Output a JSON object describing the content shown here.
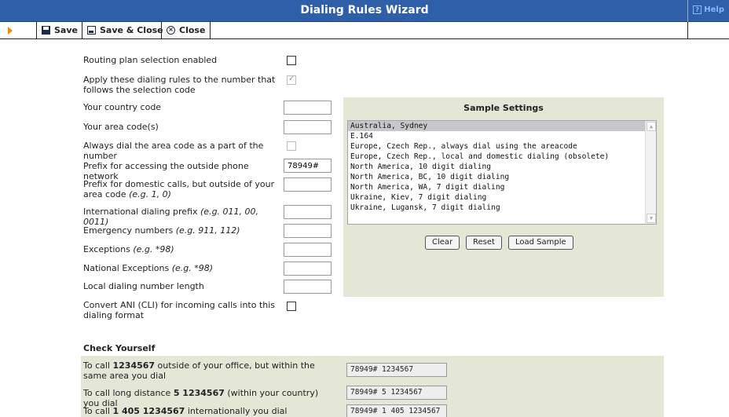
{
  "window": {
    "title": "Dialing Rules Wizard",
    "help_label": "Help",
    "help_icon": "?"
  },
  "toolbar": {
    "save_label": "Save",
    "save_close_label": "Save & Close",
    "close_label": "Close"
  },
  "form": {
    "routing_plan_label": "Routing plan selection enabled",
    "routing_plan_checked": false,
    "apply_rules_label": "Apply these dialing rules to the number that follows the selection code",
    "apply_rules_checked": true,
    "country_code_label": "Your country code",
    "country_code_value": "",
    "area_codes_label": "Your area code(s)",
    "area_codes_value": "",
    "always_dial_area_label": "Always dial the area code as a part of the number",
    "always_dial_area_checked": false,
    "outside_prefix_label": "Prefix for accessing the outside phone network",
    "outside_prefix_value": "78949#",
    "domestic_prefix_label": "Prefix for domestic calls, but outside of your area code",
    "domestic_prefix_hint": "(e.g. 1, 0)",
    "domestic_prefix_value": "",
    "intl_prefix_label": "International dialing prefix",
    "intl_prefix_hint": "(e.g. 011, 00, 0011)",
    "intl_prefix_value": "",
    "emergency_label": "Emergency numbers",
    "emergency_hint": "(e.g. 911, 112)",
    "emergency_value": "",
    "exceptions_label": "Exceptions",
    "exceptions_hint": "(e.g. *98)",
    "exceptions_value": "",
    "national_exceptions_label": "National Exceptions",
    "national_exceptions_hint": "(e.g. *98)",
    "national_exceptions_value": "",
    "local_length_label": "Local dialing number length",
    "local_length_value": "",
    "convert_ani_label": "Convert ANI (CLI) for incoming calls into this dialing format",
    "convert_ani_checked": false
  },
  "sample": {
    "title": "Sample Settings",
    "options": [
      "Australia, Sydney",
      "E.164",
      "Europe, Czech Rep., always dial using the areacode",
      "Europe, Czech Rep., local and domestic dialing (obsolete)",
      "North America, 10 digit dialing",
      "North America, BC, 10 digit dialing",
      "North America, WA, 7 digit dialing",
      "Ukraine, Kiev, 7 digit dialing",
      "Ukraine, Lugansk, 7 digit dialing"
    ],
    "selected_index": 0,
    "clear_label": "Clear",
    "reset_label": "Reset",
    "load_label": "Load Sample"
  },
  "check": {
    "title": "Check Yourself",
    "local_pre": "To call ",
    "local_num": "1234567",
    "local_post": " outside of your office, but within the same area you dial",
    "local_result": "78949# 1234567",
    "long_pre": "To call long distance ",
    "long_num": "5 1234567",
    "long_post": " (within your country) you dial",
    "long_result": "78949# 5 1234567",
    "intl_pre": "To call ",
    "intl_num": "1 405 1234567",
    "intl_post": " internationally you dial",
    "intl_result": "78949# 1 405 1234567"
  },
  "colors": {
    "titlebar": "#2f5fa8",
    "panel": "#e4e6d6",
    "toolbar_arrow": "#f08a00"
  }
}
